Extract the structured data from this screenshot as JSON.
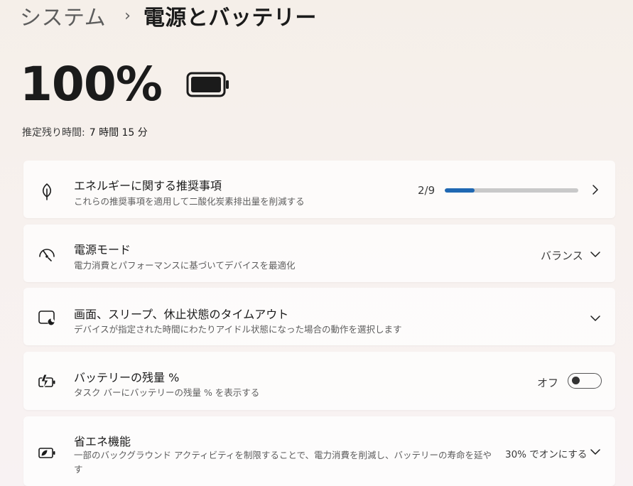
{
  "breadcrumb": {
    "parent": "システム",
    "separator": "›",
    "current": "電源とバッテリー"
  },
  "battery": {
    "percent_label": "100%",
    "level": 1.0,
    "remaining_label": "推定残り時間:",
    "remaining_value": "7 時間 15 分"
  },
  "cards": {
    "energy": {
      "title": "エネルギーに関する推奨事項",
      "subtitle": "これらの推奨事項を適用して二酸化炭素排出量を削減する",
      "progress_label": "2/9",
      "progress_fraction": 0.222,
      "icon": "leaf-icon"
    },
    "power_mode": {
      "title": "電源モード",
      "subtitle": "電力消費とパフォーマンスに基づいてデバイスを最適化",
      "value": "バランス",
      "icon": "speedometer-icon"
    },
    "timeout": {
      "title": "画面、スリープ、休止状態のタイムアウト",
      "subtitle": "デバイスが指定された時間にわたりアイドル状態になった場合の動作を選択します",
      "icon": "screen-sleep-icon"
    },
    "battery_percent": {
      "title": "バッテリーの残量 %",
      "subtitle": "タスク バーにバッテリーの残量 % を表示する",
      "toggle_label": "オフ",
      "toggle_on": false,
      "icon": "battery-charging-icon"
    },
    "energy_saver": {
      "title": "省エネ機能",
      "subtitle_line1": "一部のバックグラウンド アクティビティを制限することで、電力消費を削減し、バッテリーの寿命を延や",
      "subtitle_line2": "す",
      "value": "30% でオンにする",
      "icon": "battery-saver-icon"
    }
  },
  "colors": {
    "accent": "#1f68b3",
    "progress_track": "#c9c9c9"
  }
}
